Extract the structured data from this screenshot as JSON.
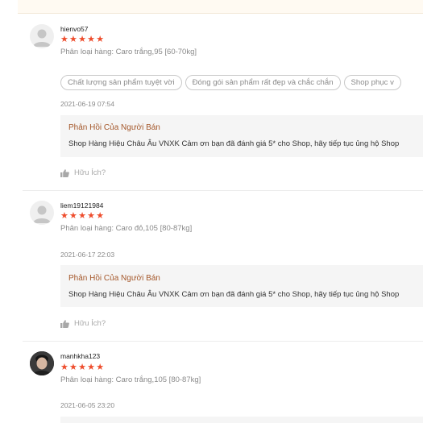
{
  "reviews": [
    {
      "username": "hienvo57",
      "rating": 5,
      "stars": "★★★★★",
      "variation": "Phân loại hàng: Caro trắng,95 [60-70kg]",
      "tags": [
        "Chất lượng sản phẩm tuyệt vời",
        "Đóng gói sản phẩm rất đẹp và chắc chắn",
        "Shop phục v"
      ],
      "datetime": "2021-06-19 07:54",
      "seller_title": "Phản Hồi Của Người Bán",
      "seller_text": "Shop Hàng Hiệu Châu Âu VNXK Cảm ơn bạn đã đánh giá 5* cho Shop, hãy tiếp tục ủng hộ Shop",
      "helpful_label": "Hữu Ích?"
    },
    {
      "username": "liem19121984",
      "rating": 5,
      "stars": "★★★★★",
      "variation": "Phân loại hàng: Caro đỏ,105 [80-87kg]",
      "datetime": "2021-06-17 22:03",
      "seller_title": "Phản Hồi Của Người Bán",
      "seller_text": "Shop Hàng Hiệu Châu Âu VNXK Cảm ơn bạn đã đánh giá 5* cho Shop, hãy tiếp tục ủng hộ Shop",
      "helpful_label": "Hữu Ích?"
    },
    {
      "username": "manhkha123",
      "rating": 5,
      "stars": "★★★★★",
      "variation": "Phân loại hàng: Caro trắng,105 [80-87kg]",
      "datetime": "2021-06-05 23:20"
    }
  ],
  "icons": {
    "avatar": "default-user-icon",
    "helpful": "thumbs-up-icon"
  },
  "colors": {
    "star": "#ee4d2d",
    "seller_title": "#a4572a",
    "seller_bg": "#f5f5f5"
  }
}
